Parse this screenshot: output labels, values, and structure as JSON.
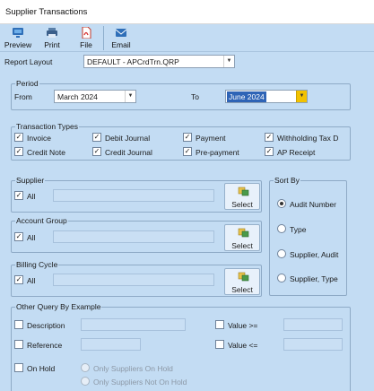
{
  "window": {
    "title": "Supplier Transactions"
  },
  "toolbar": {
    "buttons": [
      {
        "label": "Preview",
        "icon": "monitor-icon"
      },
      {
        "label": "Print",
        "icon": "printer-icon"
      },
      {
        "label": "File",
        "icon": "pdf-file-icon"
      },
      {
        "label": "Email",
        "icon": "email-icon"
      }
    ]
  },
  "report_layout": {
    "label": "Report Layout",
    "value": "DEFAULT - APCrdTrn.QRP"
  },
  "period": {
    "title": "Period",
    "from_label": "From",
    "from_value": "March 2024",
    "to_label": "To",
    "to_value": "June 2024"
  },
  "transaction_types": {
    "title": "Transaction Types",
    "items": [
      {
        "label": "Invoice",
        "checked": true
      },
      {
        "label": "Debit Journal",
        "checked": true
      },
      {
        "label": "Payment",
        "checked": true
      },
      {
        "label": "Withholding Tax D",
        "checked": true
      },
      {
        "label": "Credit Note",
        "checked": true
      },
      {
        "label": "Credit Journal",
        "checked": true
      },
      {
        "label": "Pre-payment",
        "checked": true
      },
      {
        "label": "AP Receipt",
        "checked": true
      }
    ]
  },
  "supplier": {
    "title": "Supplier",
    "all_label": "All",
    "select_label": "Select"
  },
  "account_group": {
    "title": "Account Group",
    "all_label": "All",
    "select_label": "Select"
  },
  "billing_cycle": {
    "title": "Billing Cycle",
    "all_label": "All",
    "select_label": "Select"
  },
  "sort_by": {
    "title": "Sort By",
    "options": [
      {
        "label": "Audit Number",
        "selected": true
      },
      {
        "label": "Type",
        "selected": false
      },
      {
        "label": "Supplier, Audit",
        "selected": false
      },
      {
        "label": "Supplier, Type",
        "selected": false
      }
    ]
  },
  "other_query": {
    "title": "Other Query By Example",
    "description_label": "Description",
    "reference_label": "Reference",
    "value_gte_label": "Value >=",
    "value_lte_label": "Value <=",
    "on_hold_label": "On Hold",
    "only_on_hold_label": "Only Suppliers On Hold",
    "only_not_on_hold_label": "Only Suppliers Not On Hold"
  },
  "colors": {
    "background": "#c3dcf3",
    "highlight": "#2f64b6",
    "dropdown_accent": "#f2c200"
  }
}
